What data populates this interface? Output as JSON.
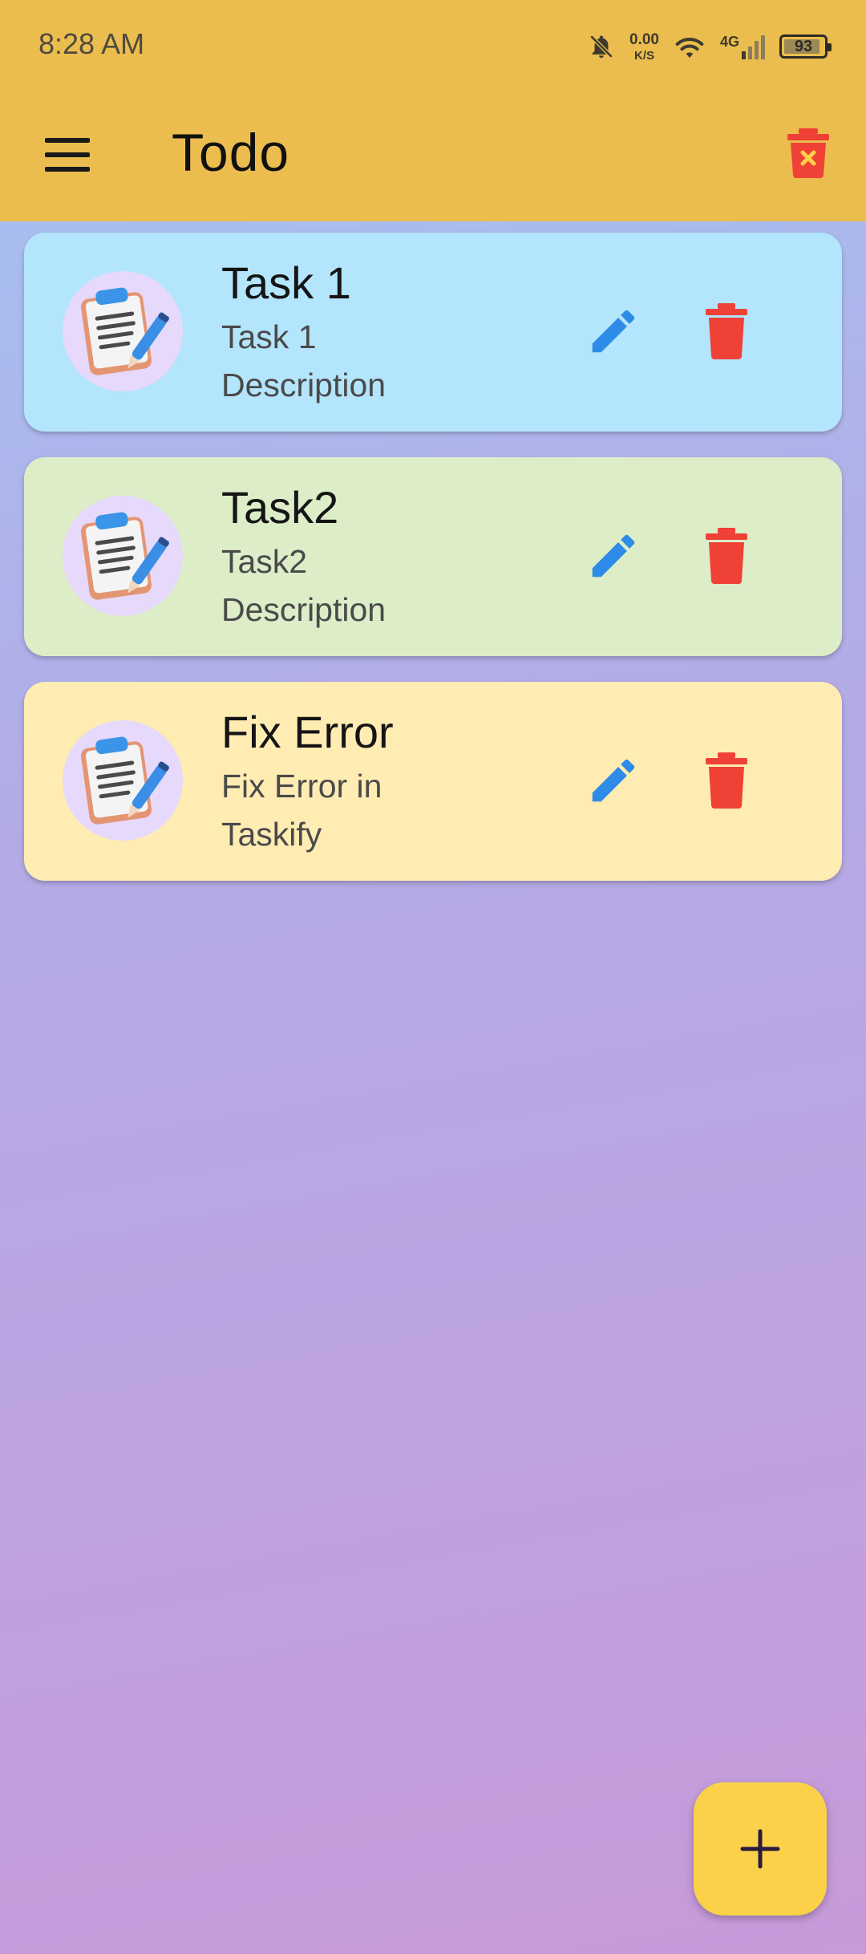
{
  "status_bar": {
    "time": "8:28 AM",
    "speed_value": "0.00",
    "speed_unit": "K/S",
    "network": "4G",
    "battery": "93",
    "icons": [
      "bell-off-icon",
      "wifi-icon",
      "signal-icon",
      "battery-icon"
    ]
  },
  "app_bar": {
    "title": "Todo",
    "menu_icon": "menu-icon",
    "clear_icon": "delete-all-icon"
  },
  "todos": [
    {
      "title": "Task 1",
      "description_line1": "Task 1",
      "description_line2": "Description",
      "color": "#b3e5fc"
    },
    {
      "title": "Task2",
      "description_line1": "Task2",
      "description_line2": "Description",
      "color": "#dcedc8"
    },
    {
      "title": "Fix Error",
      "description_line1": "Fix Error in",
      "description_line2": "Taskify",
      "color": "#ffecb3"
    }
  ],
  "fab": {
    "label": "+"
  },
  "colors": {
    "app_bar": "#ebbd4e",
    "edit": "#2e8ce8",
    "delete": "#ef4136",
    "fab": "#fbd149"
  }
}
